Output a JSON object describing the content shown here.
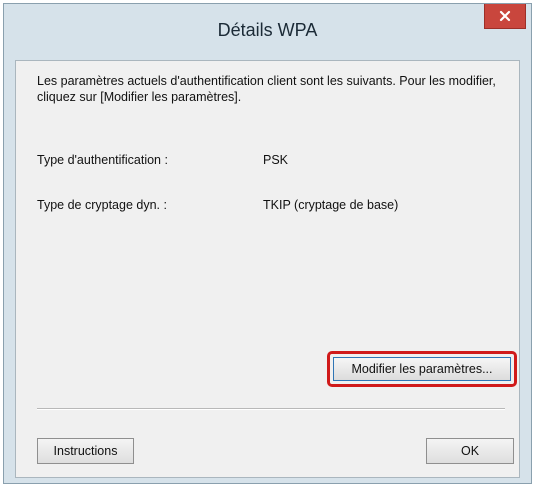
{
  "window": {
    "title": "Détails WPA"
  },
  "intro": {
    "text": "Les paramètres actuels d'authentification client sont les suivants. Pour les modifier, cliquez sur [Modifier les paramètres]."
  },
  "details": [
    {
      "label": "Type d'authentification :",
      "value": "PSK"
    },
    {
      "label": "Type de cryptage dyn. :",
      "value": "TKIP (cryptage de base)"
    }
  ],
  "buttons": {
    "modify": "Modifier les paramètres...",
    "instructions": "Instructions",
    "ok": "OK"
  },
  "icons": {
    "close": "close-icon"
  },
  "colors": {
    "close_button": "#c9463d",
    "highlight_border": "#d01a1a",
    "title_bar": "#d6e2ea"
  }
}
